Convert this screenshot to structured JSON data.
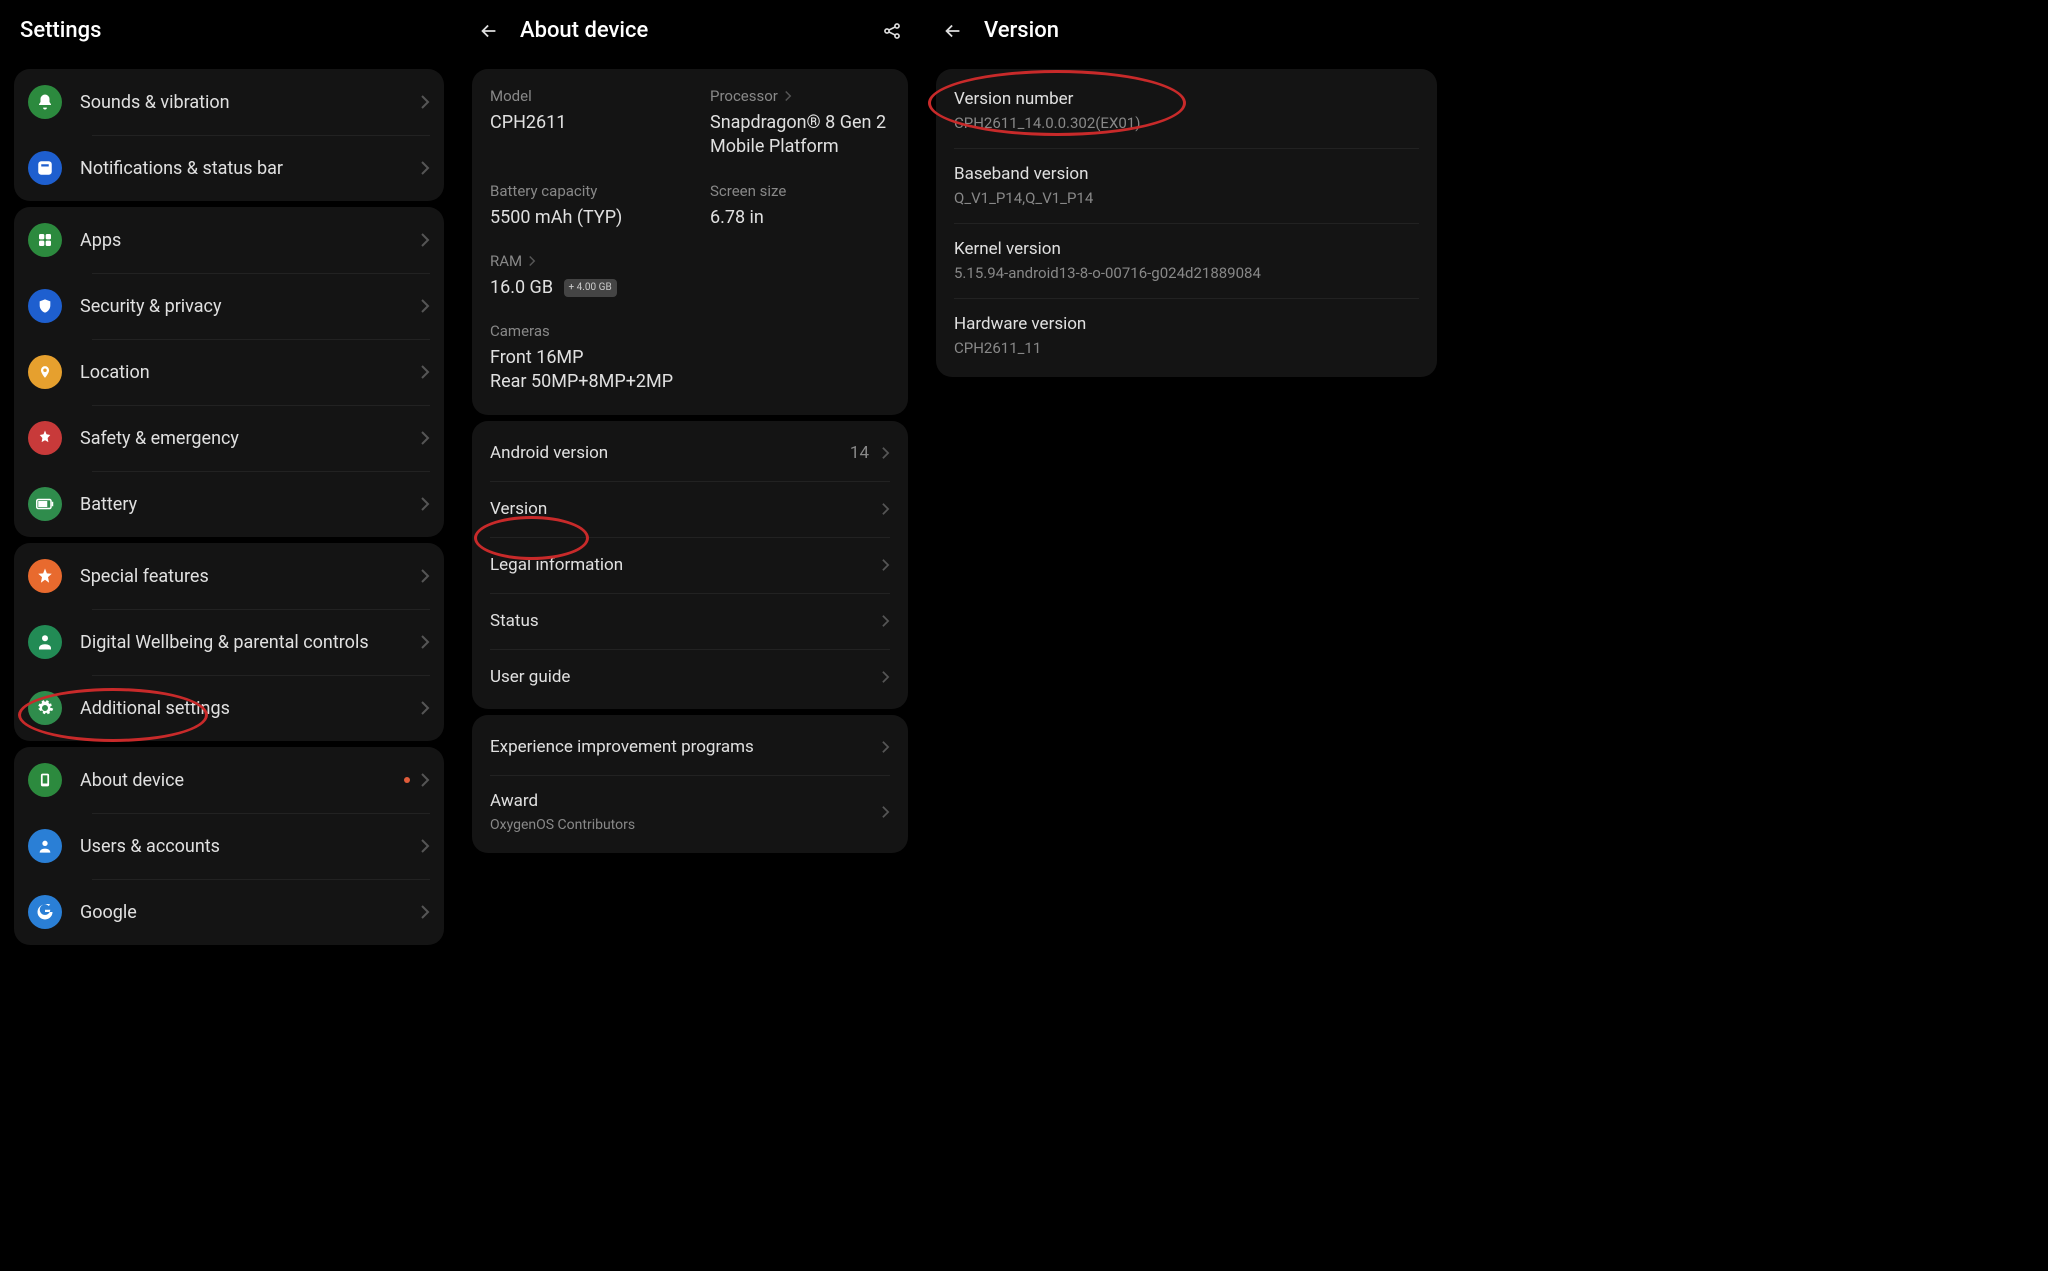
{
  "panel1": {
    "title": "Settings",
    "group1": [
      {
        "label": "Sounds & vibration"
      },
      {
        "label": "Notifications & status bar"
      }
    ],
    "group2": [
      {
        "label": "Apps"
      },
      {
        "label": "Security & privacy"
      },
      {
        "label": "Location"
      },
      {
        "label": "Safety & emergency"
      },
      {
        "label": "Battery"
      }
    ],
    "group3": [
      {
        "label": "Special features"
      },
      {
        "label": "Digital Wellbeing & parental controls"
      },
      {
        "label": "Additional settings"
      }
    ],
    "group4": [
      {
        "label": "About device"
      },
      {
        "label": "Users & accounts"
      },
      {
        "label": "Google"
      }
    ]
  },
  "panel2": {
    "title": "About device",
    "specs": {
      "model_label": "Model",
      "model_val": "CPH2611",
      "processor_label": "Processor",
      "processor_val": "Snapdragon® 8 Gen 2 Mobile Platform",
      "battery_label": "Battery capacity",
      "battery_val": "5500 mAh (TYP)",
      "screen_label": "Screen size",
      "screen_val": "6.78 in",
      "ram_label": "RAM",
      "ram_val": "16.0 GB",
      "ram_ext": "+ 4.00 GB",
      "cameras_label": "Cameras",
      "cameras_front": "Front 16MP",
      "cameras_rear": "Rear 50MP+8MP+2MP"
    },
    "list": [
      {
        "label": "Android version",
        "val": "14"
      },
      {
        "label": "Version"
      },
      {
        "label": "Legal information"
      },
      {
        "label": "Status"
      },
      {
        "label": "User guide"
      }
    ],
    "list2": [
      {
        "label": "Experience improvement programs"
      },
      {
        "label": "Award",
        "sub": "OxygenOS Contributors"
      }
    ]
  },
  "panel3": {
    "title": "Version",
    "items": [
      {
        "label": "Version number",
        "val": "CPH2611_14.0.0.302(EX01)"
      },
      {
        "label": "Baseband version",
        "val": "Q_V1_P14,Q_V1_P14"
      },
      {
        "label": "Kernel version",
        "val": "5.15.94-android13-8-o-00716-g024d21889084"
      },
      {
        "label": "Hardware version",
        "val": "CPH2611_11"
      }
    ]
  }
}
